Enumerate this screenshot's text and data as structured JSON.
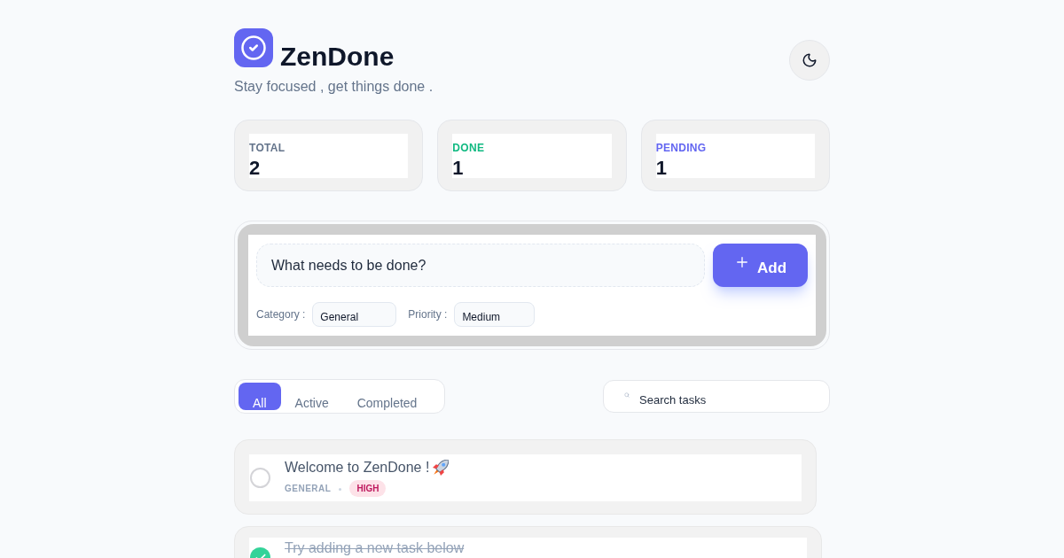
{
  "header": {
    "title": "ZenDone",
    "subtitle": "Stay focused , get things done ."
  },
  "stats": [
    {
      "label": "TOTAL",
      "value": "2",
      "color": "#64748b"
    },
    {
      "label": "DONE",
      "value": "1",
      "color": "#10b981"
    },
    {
      "label": "PENDING",
      "value": "1",
      "color": "#6366f1"
    }
  ],
  "new_task": {
    "placeholder": "What needs to be done?",
    "add_button": "Add",
    "category": {
      "label": "Category :",
      "value": "General"
    },
    "priority": {
      "label": "Priority :",
      "value": "Medium"
    }
  },
  "filters": [
    {
      "label": "All",
      "selected": true
    },
    {
      "label": "Active",
      "selected": false
    },
    {
      "label": "Completed",
      "selected": false
    }
  ],
  "search": {
    "placeholder": "Search tasks"
  },
  "tasks": [
    {
      "title": "Welcome to ZenDone !",
      "done": false,
      "category": "GENERAL",
      "priority": "HIGH"
    },
    {
      "title": "Try adding a new task below",
      "done": true
    }
  ]
}
